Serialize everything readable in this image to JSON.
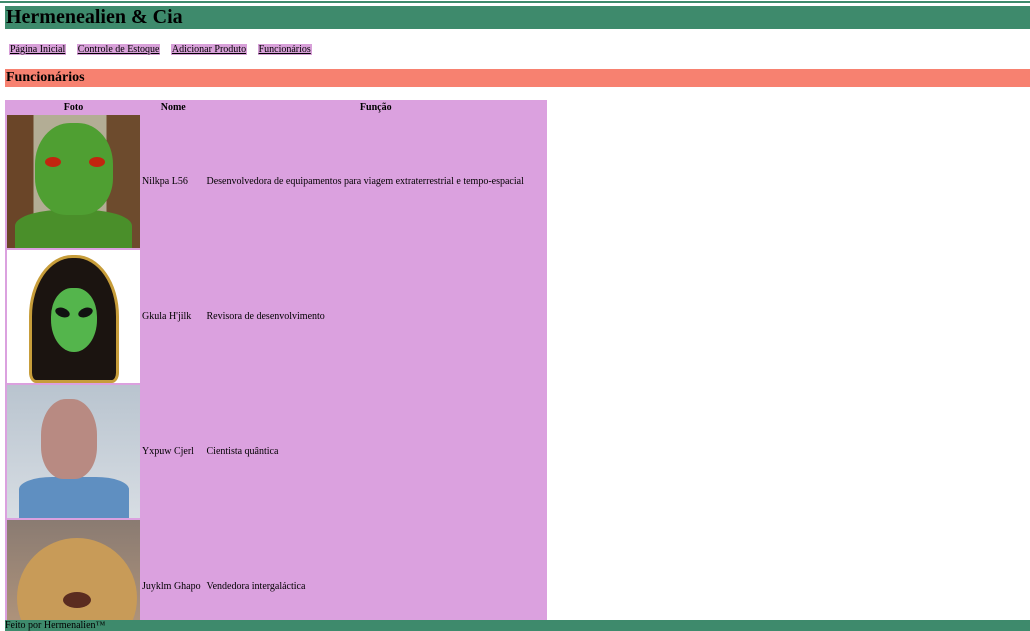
{
  "header": {
    "title": "Hermenealien & Cia"
  },
  "nav": {
    "items": [
      "Página Inicial",
      "Controle de Estoque",
      "Adicionar Produto",
      "Funcionários"
    ]
  },
  "section": {
    "title": "Funcionários"
  },
  "table": {
    "headers": {
      "photo": "Foto",
      "name": "Nome",
      "role": "Função"
    },
    "rows": [
      {
        "name": "Nilkpa L56",
        "role": "Desenvolvedora de equipamentos para viagem extraterrestrial e tempo-espacial"
      },
      {
        "name": "Gkula H'jilk",
        "role": "Revisora de desenvolvimento"
      },
      {
        "name": "Yxpuw Cjerl",
        "role": "Cientista quântica"
      },
      {
        "name": "Juyklm Ghapo",
        "role": "Vendedora intergaláctica"
      }
    ]
  },
  "footer": {
    "text": "Feito por Hermenalien™"
  },
  "colors": {
    "header": "#3e8a6c",
    "section": "#f78170",
    "table": "#dba1df",
    "nav_link_bg": "#d8a0d9"
  }
}
